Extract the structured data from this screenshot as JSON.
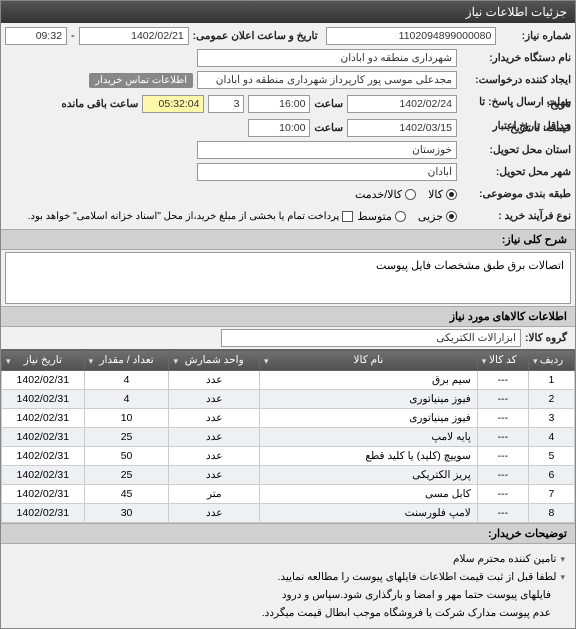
{
  "header": {
    "title": "جزئیات اطلاعات نیاز"
  },
  "form": {
    "req_no_label": "شماره نیاز:",
    "req_no": "1102094899000080",
    "ann_dt_label": "تاریخ و ساعت اعلان عمومی:",
    "ann_date": "1402/02/21",
    "ann_time": "09:32",
    "sep": " - ",
    "buyer_label": "نام دستگاه خریدار:",
    "buyer": "شهرداری منطقه دو آبادان",
    "creator_label": "ایجاد کننده درخواست:",
    "creator": "مجدعلی موسی پور کارپرداز شهرداری منطقه دو آبادان",
    "contact_chip": "اطلاعات تماس خریدار",
    "reply_dl_label_a": "مهلت ارسال پاسخ: تا",
    "reply_dl_label_b": "تاریخ:",
    "reply_date": "1402/02/24",
    "hour_label": "ساعت",
    "reply_hour": "16:00",
    "rem_days": "3",
    "rem_time": "05:32:04",
    "rem_suffix": "ساعت باقی مانده",
    "valid_label_a": "حداقل تاریخ اعتبار",
    "valid_label_b": "قیمت: تا تاریخ:",
    "valid_date": "1402/03/15",
    "valid_hour": "10:00",
    "province_label": "استان محل تحویل:",
    "province": "خوزستان",
    "city_label": "شهر محل تحویل:",
    "city": "آبادان",
    "class_label": "طبقه بندی موضوعی:",
    "class_goods": "کالا",
    "class_service": "کالا/خدمت",
    "proc_label": "نوع فرآیند خرید :",
    "proc_minor": "جزیی",
    "proc_med": "متوسط",
    "proc_note": "پرداخت تمام یا بخشی از مبلغ خرید،از محل \"اسناد خزانه اسلامی\" خواهد بود."
  },
  "desc_title": "شرح کلی نیاز:",
  "desc_text": "اتصالات برق طبق مشخصات فایل پیوست",
  "items_title": "اطلاعات کالاهای مورد نیاز",
  "group_label": "گروه کالا:",
  "group_value": "ابزارآلات الکتریکی",
  "cols": {
    "idx": "ردیف",
    "code": "کد کالا",
    "name": "نام کالا",
    "unit": "واحد شمارش",
    "qty": "تعداد / مقدار",
    "date": "تاریخ نیاز"
  },
  "rows": [
    {
      "idx": "1",
      "code": "---",
      "name": "سیم برق",
      "unit": "عدد",
      "qty": "4",
      "date": "1402/02/31"
    },
    {
      "idx": "2",
      "code": "---",
      "name": "فیوز مینیاتوری",
      "unit": "عدد",
      "qty": "4",
      "date": "1402/02/31"
    },
    {
      "idx": "3",
      "code": "---",
      "name": "فیوز مینیاتوری",
      "unit": "عدد",
      "qty": "10",
      "date": "1402/02/31"
    },
    {
      "idx": "4",
      "code": "---",
      "name": "پایه لامپ",
      "unit": "عدد",
      "qty": "25",
      "date": "1402/02/31"
    },
    {
      "idx": "5",
      "code": "---",
      "name": "سوییچ (کلید) یا کلید قطع",
      "unit": "عدد",
      "qty": "50",
      "date": "1402/02/31"
    },
    {
      "idx": "6",
      "code": "---",
      "name": "پریز الکتریکی",
      "unit": "عدد",
      "qty": "25",
      "date": "1402/02/31"
    },
    {
      "idx": "7",
      "code": "---",
      "name": "کابل مسی",
      "unit": "متر",
      "qty": "45",
      "date": "1402/02/31"
    },
    {
      "idx": "8",
      "code": "---",
      "name": "لامپ فلورسنت",
      "unit": "عدد",
      "qty": "30",
      "date": "1402/02/31"
    }
  ],
  "buyer_title": "توضیحات خریدار:",
  "notes": [
    "تامین کننده محترم سلام",
    "لطفا قبل از ثبت قیمت اطلاعات فایلهای پیوست را مطالعه نمایید.",
    "فایلهای پیوست حتما مهر و امضا و بارگذاری شود.سپاس و درود",
    "عدم پیوست مدارک شرکت یا فروشگاه موجب ابطال قیمت میگردد."
  ]
}
